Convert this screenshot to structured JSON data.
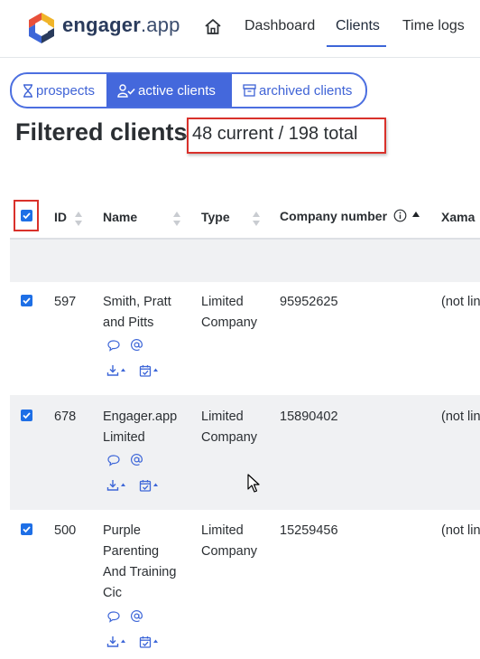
{
  "nav": {
    "brand_bold": "engager",
    "brand_light": ".app",
    "links": [
      "Dashboard",
      "Clients",
      "Time logs"
    ],
    "active": "Clients"
  },
  "filters": {
    "prospects": "prospects",
    "active_clients": "active clients",
    "archived_clients": "archived clients",
    "active": "active clients"
  },
  "page": {
    "title": "Filtered clients",
    "dash": "-",
    "count": "48 current / 198 total"
  },
  "table": {
    "columns": [
      "ID",
      "Name",
      "Type",
      "Company number",
      "Xama"
    ],
    "rows": [
      {
        "checked": true,
        "id": "597",
        "name_lines": [
          "Smith, Pratt",
          "and Pitts"
        ],
        "type_lines": [
          "Limited",
          "Company"
        ],
        "company_number": "95952625",
        "xama": "(not lin"
      },
      {
        "checked": true,
        "id": "678",
        "name_lines": [
          "Engager.app",
          "Limited"
        ],
        "type_lines": [
          "Limited",
          "Company"
        ],
        "company_number": "15890402",
        "xama": "(not lin"
      },
      {
        "checked": true,
        "id": "500",
        "name_lines": [
          "Purple",
          "Parenting",
          "And Training",
          "Cic"
        ],
        "type_lines": [
          "Limited",
          "Company"
        ],
        "company_number": "15259456",
        "xama": "(not lin"
      }
    ]
  },
  "colors": {
    "accent": "#4468dc",
    "checkbox": "#1e6fe6",
    "highlight_border": "#d9312b",
    "row_alt": "#f0f1f3"
  },
  "icons": [
    "logo-icon",
    "home-icon",
    "hourglass-icon",
    "user-check-icon",
    "archive-icon",
    "sort-icon",
    "info-icon",
    "chat-icon",
    "at-icon",
    "download-icon",
    "calendar-icon",
    "mouse-cursor-icon"
  ]
}
